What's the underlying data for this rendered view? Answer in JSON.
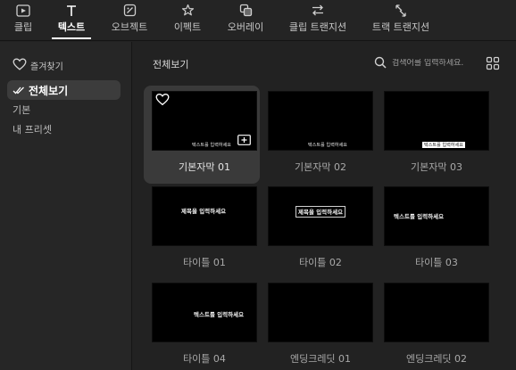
{
  "tabs": [
    {
      "label": "클립",
      "icon": "clip-icon",
      "active": false
    },
    {
      "label": "텍스트",
      "icon": "text-icon",
      "active": true
    },
    {
      "label": "오브젝트",
      "icon": "object-icon",
      "active": false
    },
    {
      "label": "이펙트",
      "icon": "effect-icon",
      "active": false
    },
    {
      "label": "오버레이",
      "icon": "overlay-icon",
      "active": false
    },
    {
      "label": "클립 트랜지션",
      "icon": "clip-transition-icon",
      "active": false
    },
    {
      "label": "트랙 트랜지션",
      "icon": "track-transition-icon",
      "active": false
    }
  ],
  "sidebar": {
    "favorites_label": "즐겨찾기",
    "items": [
      {
        "label": "전체보기",
        "active": true
      },
      {
        "label": "기본",
        "active": false
      },
      {
        "label": "내 프리셋",
        "active": false
      }
    ]
  },
  "main": {
    "title": "전체보기",
    "search_placeholder": "검색어를 입력하세요."
  },
  "cards": [
    {
      "label": "기본자막 01",
      "preview": "텍스트를 입력하세요",
      "selected": true
    },
    {
      "label": "기본자막 02",
      "preview": "텍스트를 입력하세요",
      "selected": false
    },
    {
      "label": "기본자막 03",
      "preview": "텍스트를 입력하세요",
      "selected": false
    },
    {
      "label": "타이틀 01",
      "preview": "제목을 입력하세요",
      "selected": false
    },
    {
      "label": "타이틀 02",
      "preview": "제목을 입력하세요",
      "selected": false
    },
    {
      "label": "타이틀 03",
      "preview": "텍스트를 입력하세요",
      "selected": false
    },
    {
      "label": "타이틀 04",
      "preview": "텍스트를 입력하세요",
      "selected": false
    },
    {
      "label": "엔딩크레딧 01",
      "preview": "",
      "selected": false
    },
    {
      "label": "엔딩크레딧 02",
      "preview": "",
      "selected": false
    }
  ],
  "colors": {
    "background": "#222222",
    "sidebar": "#262626",
    "selected_card": "#3a3a3a",
    "active_tab": "#ffffff"
  }
}
